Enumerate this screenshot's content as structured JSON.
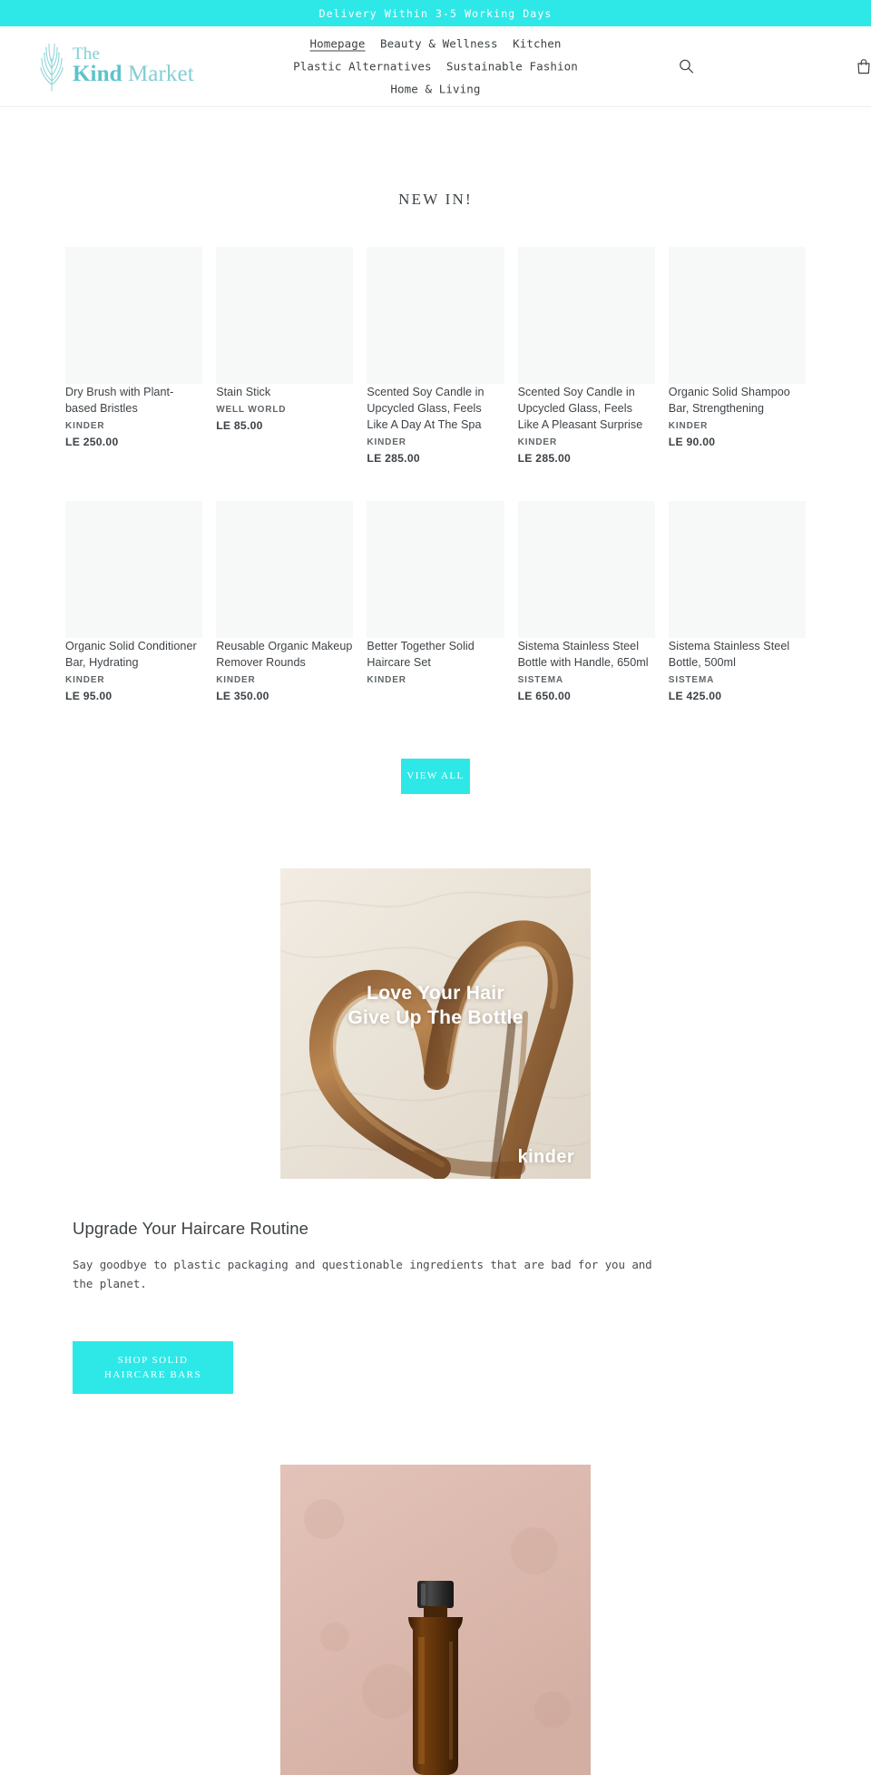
{
  "announcement": {
    "text": "Delivery Within 3-5 Working Days",
    "background": "#2ee8e8"
  },
  "header": {
    "logo": {
      "line1": "The",
      "line2_bold": "Kind",
      "line2_light": " Market",
      "color": "#7fcfd4"
    },
    "nav": [
      {
        "label": "Homepage",
        "active": true
      },
      {
        "label": "Beauty & Wellness",
        "active": false
      },
      {
        "label": "Kitchen",
        "active": false
      },
      {
        "label": "Plastic Alternatives",
        "active": false
      },
      {
        "label": "Sustainable Fashion",
        "active": false
      },
      {
        "label": "Home & Living",
        "active": false
      }
    ],
    "icons": {
      "search": "search-icon",
      "cart": "shopping-bag-icon"
    }
  },
  "new_in": {
    "title": "NEW IN!",
    "products": [
      {
        "title": "Dry Brush with Plant-based Bristles",
        "vendor": "KINDER",
        "price": "LE 250.00"
      },
      {
        "title": "Stain Stick",
        "vendor": "WELL WORLD",
        "price": "LE 85.00"
      },
      {
        "title": "Scented Soy Candle in Upcycled Glass, Feels Like A Day At The Spa",
        "vendor": "KINDER",
        "price": "LE 285.00"
      },
      {
        "title": "Scented Soy Candle in Upcycled Glass, Feels Like A Pleasant Surprise",
        "vendor": "KINDER",
        "price": "LE 285.00"
      },
      {
        "title": "Organic Solid Shampoo Bar, Strengthening",
        "vendor": "KINDER",
        "price": "LE 90.00"
      },
      {
        "title": "Organic Solid Conditioner Bar, Hydrating",
        "vendor": "KINDER",
        "price": "LE 95.00"
      },
      {
        "title": "Reusable Organic Makeup Remover Rounds",
        "vendor": "KINDER",
        "price": "LE 350.00"
      },
      {
        "title": "Better Together Solid Haircare Set",
        "vendor": "KINDER",
        "price": ""
      },
      {
        "title": "Sistema Stainless Steel Bottle with Handle, 650ml",
        "vendor": "SISTEMA",
        "price": "LE 650.00"
      },
      {
        "title": "Sistema Stainless Steel Bottle, 500ml",
        "vendor": "SISTEMA",
        "price": "LE 425.00"
      }
    ],
    "view_all_label": "VIEW ALL"
  },
  "feature": {
    "image_caption_line1": "Love Your Hair",
    "image_caption_line2": "Give Up The Bottle",
    "image_brand": "kinder",
    "heading": "Upgrade Your Haircare Routine",
    "body": "Say goodbye to plastic packaging and questionable ingredients that are bad for you and the planet.",
    "cta_label": "SHOP SOLID HAIRCARE BARS",
    "cta_color": "#2ee8e8"
  },
  "feature2": {
    "alt": "amber glass bottle on pink background"
  }
}
